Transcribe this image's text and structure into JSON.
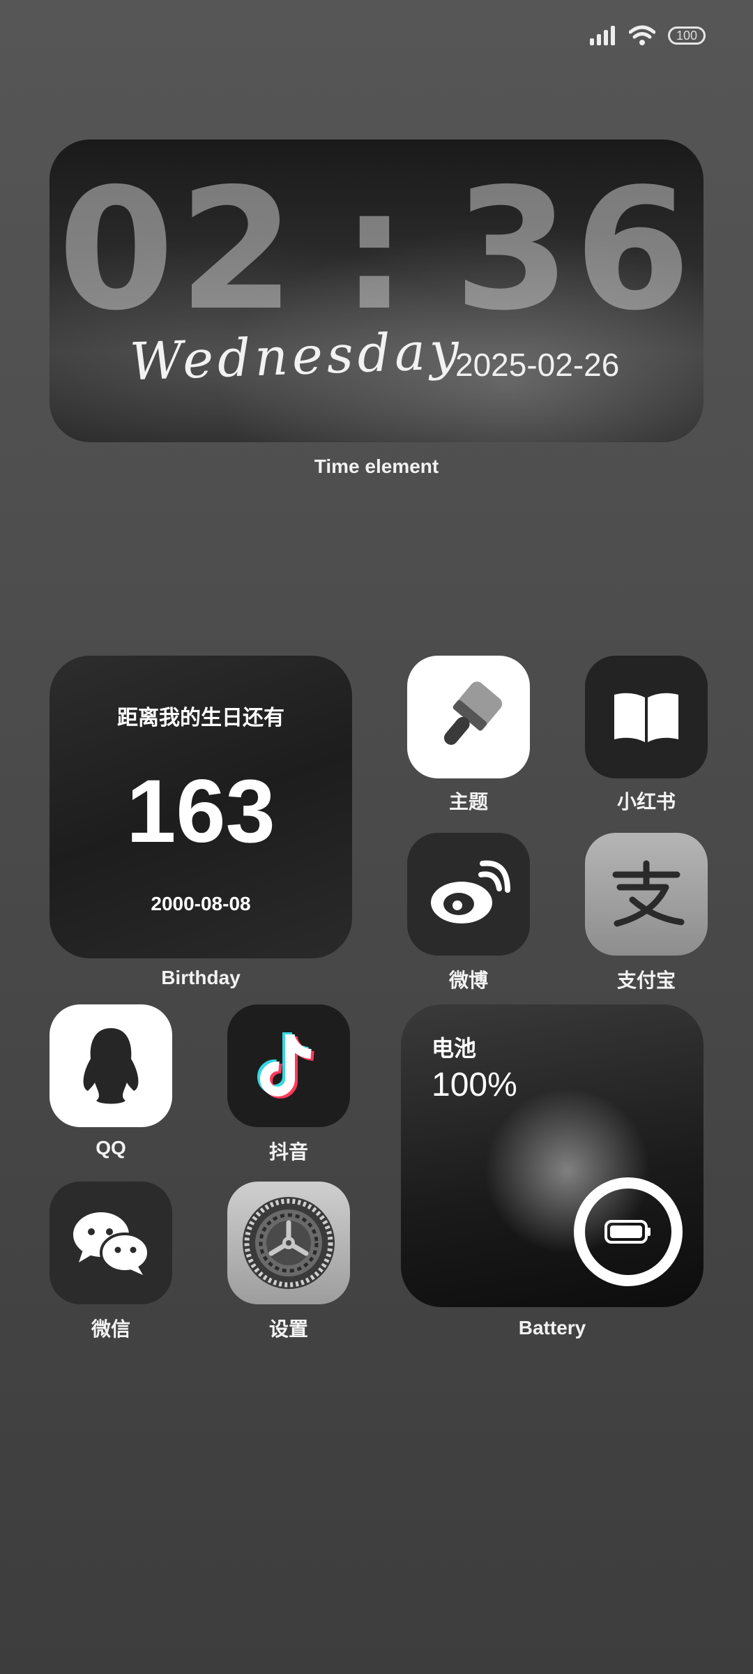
{
  "status_bar": {
    "battery_level": "100"
  },
  "time_widget": {
    "hour": "02",
    "separator": ":",
    "minute": "36",
    "weekday": "Wednesday",
    "date": "2025-02-26",
    "label": "Time element"
  },
  "birthday_widget": {
    "title": "距离我的生日还有",
    "days": "163",
    "date": "2000-08-08",
    "label": "Birthday"
  },
  "apps": {
    "theme": {
      "label": "主题",
      "icon": "paint-brush-icon"
    },
    "xiaohongshu": {
      "label": "小红书",
      "icon": "open-book-icon"
    },
    "weibo": {
      "label": "微博",
      "icon": "weibo-icon"
    },
    "alipay": {
      "label": "支付宝",
      "icon": "alipay-icon"
    },
    "qq": {
      "label": "QQ",
      "icon": "penguin-icon"
    },
    "douyin": {
      "label": "抖音",
      "icon": "tiktok-note-icon"
    },
    "wechat": {
      "label": "微信",
      "icon": "chat-bubbles-icon"
    },
    "settings": {
      "label": "设置",
      "icon": "gear-icon"
    }
  },
  "battery_widget": {
    "title": "电池",
    "percent": "100%",
    "label": "Battery"
  },
  "colors": {
    "background_top": "#565656",
    "background_bottom": "#3d3d3d",
    "icon_dark": "#222222",
    "icon_light": "#ffffff"
  }
}
